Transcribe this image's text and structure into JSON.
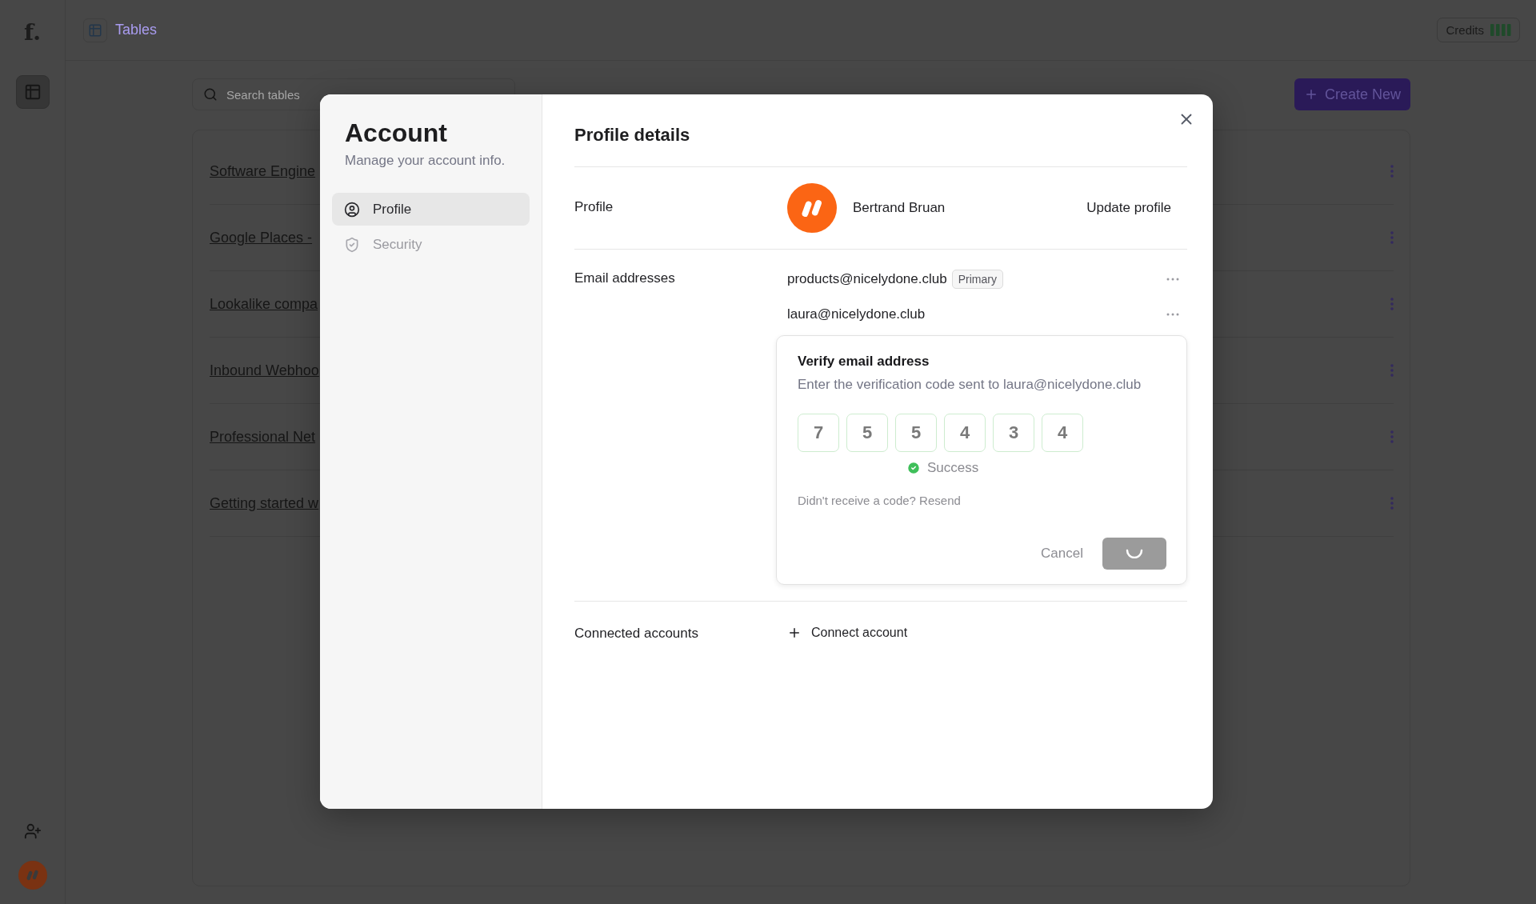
{
  "rail": {
    "logo": "f.",
    "items": [
      {
        "kind": "tables",
        "selected": true
      }
    ]
  },
  "header": {
    "title": "Tables",
    "credits": "Credits"
  },
  "search": {
    "placeholder": "Search tables"
  },
  "create_button": "Create New",
  "tables": [
    {
      "name": "Software Engine"
    },
    {
      "name": "Google Places -"
    },
    {
      "name": "Lookalike compa"
    },
    {
      "name": "Inbound Webhoo"
    },
    {
      "name": "Professional Net"
    },
    {
      "name": "Getting started w"
    }
  ],
  "modal": {
    "title": "Account",
    "subtitle": "Manage your account info.",
    "nav": [
      {
        "label": "Profile",
        "kind": "user",
        "selected": true
      },
      {
        "label": "Security",
        "kind": "shield",
        "selected": false
      }
    ],
    "heading": "Profile details",
    "profile": {
      "label": "Profile",
      "name": "Bertrand Bruan",
      "action": "Update profile"
    },
    "emails": {
      "label": "Email addresses",
      "items": [
        {
          "address": "products@nicelydone.club",
          "badge": "Primary"
        },
        {
          "address": "laura@nicelydone.club"
        }
      ]
    },
    "verify": {
      "title": "Verify email address",
      "text": "Enter the verification code sent to laura@nicelydone.club",
      "digits": [
        "7",
        "5",
        "5",
        "4",
        "3",
        "4"
      ],
      "status": "Success",
      "resend": "Didn't receive a code? Resend",
      "cancel": "Cancel",
      "loading": true
    },
    "connected": {
      "label": "Connected accounts",
      "action": "Connect account"
    }
  }
}
